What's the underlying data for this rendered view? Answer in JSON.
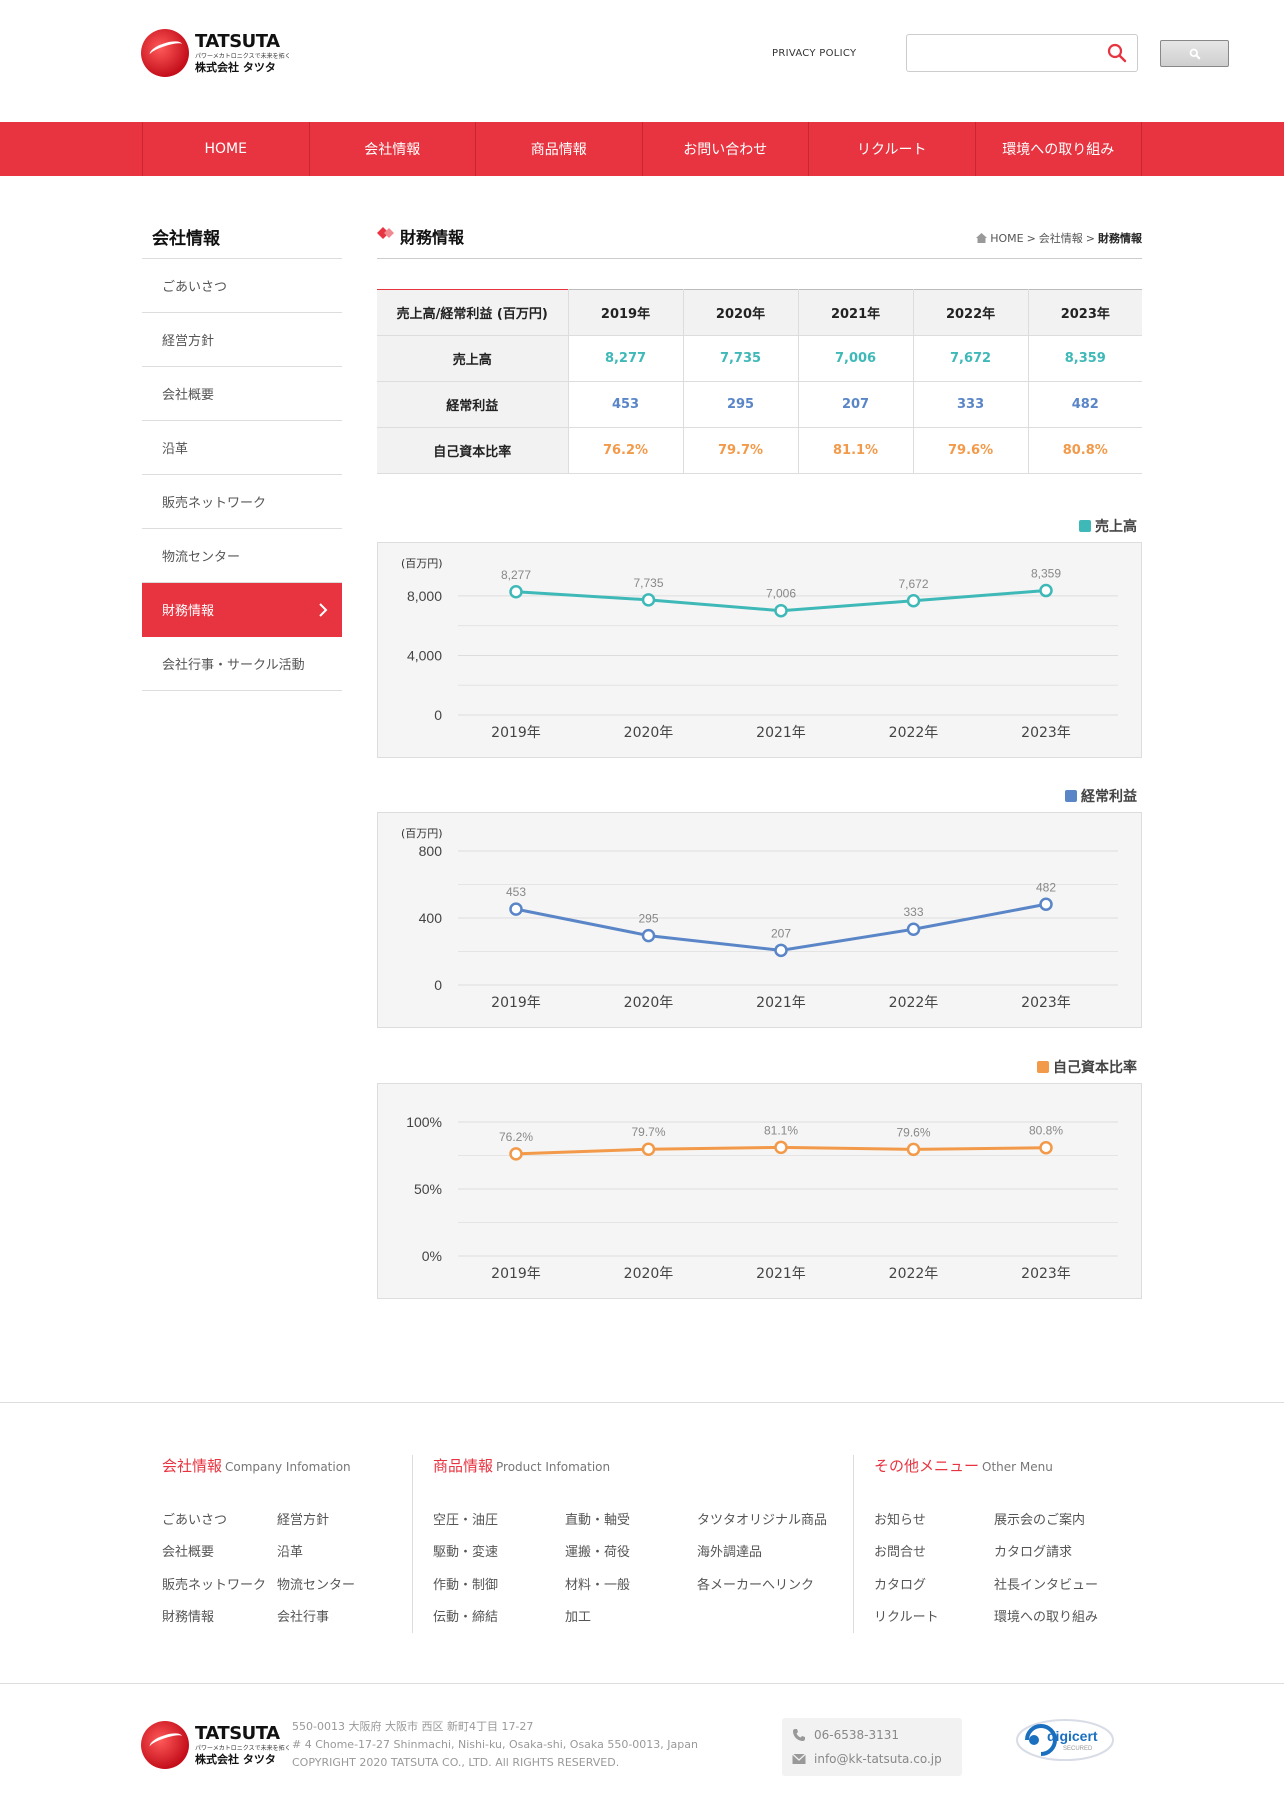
{
  "header": {
    "brand_name": "TATSUTA",
    "brand_tagline": "パワーメカトロニクスで未来を拓く",
    "brand_kana": "株式会社 タツタ",
    "privacy_label": "PRIVACY POLICY",
    "search_placeholder": ""
  },
  "nav": [
    {
      "label": "HOME"
    },
    {
      "label": "会社情報"
    },
    {
      "label": "商品情報"
    },
    {
      "label": "お問い合わせ"
    },
    {
      "label": "リクルート"
    },
    {
      "label": "環境への取り組み"
    }
  ],
  "sidebar": {
    "title": "会社情報",
    "items": [
      {
        "label": "ごあいさつ"
      },
      {
        "label": "経営方針"
      },
      {
        "label": "会社概要"
      },
      {
        "label": "沿革"
      },
      {
        "label": "販売ネットワーク"
      },
      {
        "label": "物流センター"
      },
      {
        "label": "財務情報",
        "active": true
      },
      {
        "label": "会社行事・サークル活動"
      }
    ]
  },
  "main": {
    "title": "財務情報",
    "breadcrumb": [
      "HOME",
      ">",
      "会社情報",
      ">",
      "財務情報"
    ]
  },
  "table": {
    "corner": "売上高/経常利益 (百万円)",
    "years": [
      "2019年",
      "2020年",
      "2021年",
      "2022年",
      "2023年"
    ],
    "rows": [
      {
        "label": "売上高",
        "values": [
          "8,277",
          "7,735",
          "7,006",
          "7,672",
          "8,359"
        ]
      },
      {
        "label": "経常利益",
        "values": [
          "453",
          "295",
          "207",
          "333",
          "482"
        ]
      },
      {
        "label": "自己資本比率",
        "values": [
          "76.2%",
          "79.7%",
          "81.1%",
          "79.6%",
          "80.8%"
        ]
      }
    ]
  },
  "colors": {
    "brand": "#e73440",
    "sales": "#3fb8b8",
    "profit": "#5a86c8",
    "equity": "#f29a4a"
  },
  "chart_data": [
    {
      "type": "line",
      "legend": "売上高",
      "unit_label": "(百万円)",
      "categories": [
        "2019年",
        "2020年",
        "2021年",
        "2022年",
        "2023年"
      ],
      "series": [
        {
          "name": "売上高",
          "values": [
            8277,
            7735,
            7006,
            7672,
            8359
          ]
        }
      ],
      "value_labels": [
        "8,277",
        "7,735",
        "7,006",
        "7,672",
        "8,359"
      ],
      "yticks": [
        "0",
        "4,000",
        "8,000"
      ],
      "ylim": [
        0,
        9000
      ],
      "ytick_values": [
        0,
        4000,
        8000
      ],
      "grid": true,
      "legend_position": "top-right"
    },
    {
      "type": "line",
      "legend": "経常利益",
      "unit_label": "(百万円)",
      "categories": [
        "2019年",
        "2020年",
        "2021年",
        "2022年",
        "2023年"
      ],
      "series": [
        {
          "name": "経常利益",
          "values": [
            453,
            295,
            207,
            333,
            482
          ]
        }
      ],
      "value_labels": [
        "453",
        "295",
        "207",
        "333",
        "482"
      ],
      "yticks": [
        "0",
        "400",
        "800"
      ],
      "ylim": [
        0,
        800
      ],
      "ytick_values": [
        0,
        400,
        800
      ],
      "grid": true,
      "legend_position": "top-right"
    },
    {
      "type": "line",
      "legend": "自己資本比率",
      "unit_label": "",
      "categories": [
        "2019年",
        "2020年",
        "2021年",
        "2022年",
        "2023年"
      ],
      "series": [
        {
          "name": "自己資本比率",
          "values": [
            76.2,
            79.7,
            81.1,
            79.6,
            80.8
          ]
        }
      ],
      "value_labels": [
        "76.2%",
        "79.7%",
        "81.1%",
        "79.6%",
        "80.8%"
      ],
      "yticks": [
        "0%",
        "50%",
        "100%"
      ],
      "ylim": [
        0,
        100
      ],
      "ytick_values": [
        0,
        50,
        100
      ],
      "grid": true,
      "legend_position": "top-right"
    }
  ],
  "footer": {
    "col1": {
      "title": "会社情報",
      "title_en": "Company Infomation",
      "links": [
        "ごあいさつ",
        "経営方針",
        "会社概要",
        "沿革",
        "販売ネットワーク",
        "物流センター",
        "財務情報",
        "会社行事"
      ]
    },
    "col2": {
      "title": "商品情報",
      "title_en": "Product Infomation",
      "links": [
        "空圧・油圧",
        "直動・軸受",
        "タツタオリジナル商品",
        "駆動・変速",
        "運搬・荷役",
        "海外調達品",
        "作動・制御",
        "材料・一般",
        "各メーカーへリンク",
        "伝動・締結",
        "加工"
      ]
    },
    "col3": {
      "title": "その他メニュー",
      "title_en": "Other Menu",
      "links": [
        "お知らせ",
        "展示会のご案内",
        "お問合せ",
        "カタログ請求",
        "カタログ",
        "社長インタビュー",
        "リクルート",
        "環境への取り組み"
      ]
    },
    "address_jp": "550-0013 大阪府 大阪市 西区 新町4丁目 17-27",
    "address_en": "# 4 Chome-17-27 Shinmachi, Nishi-ku, Osaka-shi, Osaka 550-0013, Japan",
    "copyright": "COPYRIGHT 2020 TATSUTA CO., LTD. All RIGHTS RESERVED.",
    "phone": "06-6538-3131",
    "email": "info@kk-tatsuta.co.jp",
    "badge_text": "digicert",
    "badge_sub": "SECURED"
  }
}
